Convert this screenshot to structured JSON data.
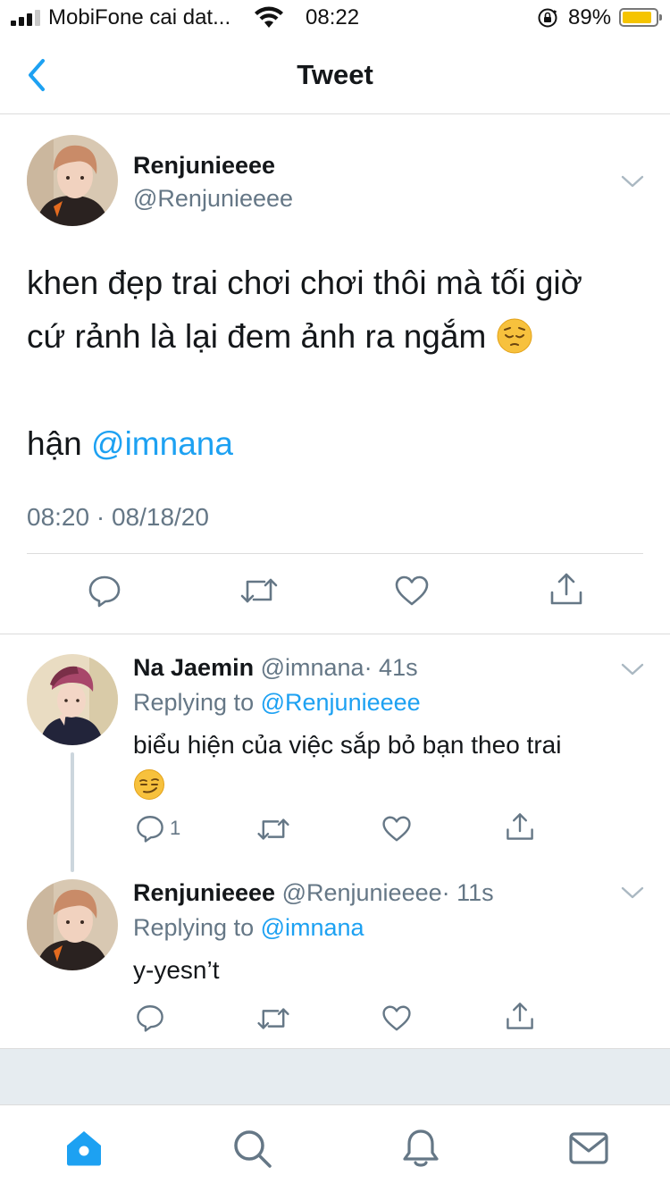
{
  "status_bar": {
    "carrier": "MobiFone cai dat...",
    "time": "08:22",
    "battery_percent": "89%",
    "battery_level": 0.89,
    "battery_color": "#f5c400",
    "signal_bars_active": 3,
    "icons": [
      "signal-icon",
      "wifi-icon",
      "orientation-lock-icon",
      "battery-icon"
    ]
  },
  "nav": {
    "title": "Tweet",
    "back_icon": "chevron-left-icon",
    "accent": "#1da1f2"
  },
  "main_tweet": {
    "name": "Renjunieeee",
    "handle": "@Renjunieeee",
    "text_line1": "khen đẹp trai chơi chơi thôi mà tối giờ",
    "text_line2": "cứ rảnh là lại đem ảnh ra ngắm",
    "text_line2_emoji": "pensive-face-emoji",
    "text_line3_prefix": "hận",
    "text_line3_mention": "@imnana",
    "timestamp": "08:20 · 08/18/20",
    "actions": [
      "reply-icon",
      "retweet-icon",
      "like-icon",
      "share-icon"
    ]
  },
  "replies": [
    {
      "name": "Na Jaemin",
      "handle": "@imnana",
      "time": "· 41s",
      "replying_prefix": "Replying to",
      "replying_to": "@Renjunieeee",
      "text": "biểu hiện của việc sắp bỏ bạn theo trai",
      "emoji": "smirking-face-emoji",
      "reply_count": "1"
    },
    {
      "name": "Renjunieeee",
      "handle": "@Renjunieeee",
      "time": "· 11s",
      "replying_prefix": "Replying to",
      "replying_to": "@imnana",
      "text": "y-yesn’t",
      "reply_count": ""
    }
  ],
  "tab_bar": {
    "tabs": [
      "home-icon",
      "search-icon",
      "notifications-icon",
      "messages-icon"
    ],
    "active": "home-icon"
  },
  "colors": {
    "text": "#14171a",
    "secondary": "#657786",
    "accent": "#1da1f2",
    "divider": "#dcdcdc",
    "background_gray": "#e6ecf0"
  }
}
